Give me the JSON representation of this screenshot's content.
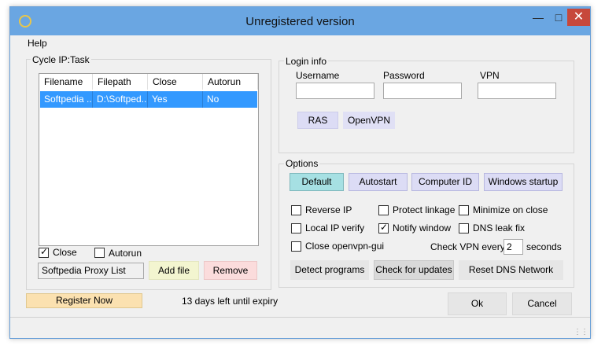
{
  "window": {
    "title": "Unregistered version"
  },
  "menu": {
    "help": "Help"
  },
  "cycle": {
    "group_label": "Cycle IP:Task",
    "columns": [
      "Filename",
      "Filepath",
      "Close",
      "Autorun"
    ],
    "rows": [
      {
        "filename": "Softpedia ...",
        "filepath": "D:\\Softped...",
        "close": "Yes",
        "autorun": "No"
      }
    ],
    "close_label": "Close",
    "close_checked": true,
    "autorun_label": "Autorun",
    "autorun_checked": false,
    "profile_value": "Softpedia Proxy List",
    "add_file": "Add file",
    "remove": "Remove"
  },
  "login": {
    "group_label": "Login info",
    "username_label": "Username",
    "password_label": "Password",
    "vpn_label": "VPN",
    "username_value": "",
    "password_value": "",
    "vpn_value": "",
    "ras": "RAS",
    "openvpn": "OpenVPN"
  },
  "options": {
    "group_label": "Options",
    "default": "Default",
    "autostart": "Autostart",
    "computer_id": "Computer ID",
    "windows_startup": "Windows startup",
    "reverse_ip": "Reverse IP",
    "protect_linkage": "Protect linkage",
    "minimize_on_close": "Minimize on close",
    "local_ip_verify": "Local IP verify",
    "notify_window": "Notify window",
    "notify_window_checked": true,
    "dns_leak_fix": "DNS leak fix",
    "close_openvpn_gui": "Close openvpn-gui",
    "check_vpn_every": "Check VPN every",
    "check_vpn_value": "2",
    "seconds": "seconds",
    "detect_programs": "Detect programs",
    "check_for_updates": "Check for updates",
    "reset_dns_network": "Reset DNS Network"
  },
  "bottom": {
    "register_now": "Register Now",
    "expiry_text": "13 days left until expiry",
    "ok": "Ok",
    "cancel": "Cancel"
  },
  "colors": {
    "titlebar": "#6aa6e2",
    "selection": "#3399ff",
    "close_button": "#c7483b",
    "default_button": "#a6e0e3",
    "purple_button": "#dcdcf5",
    "add_file_button": "#f3f5d0",
    "remove_button": "#fbdcdc",
    "register_button": "#fbe1b0"
  }
}
